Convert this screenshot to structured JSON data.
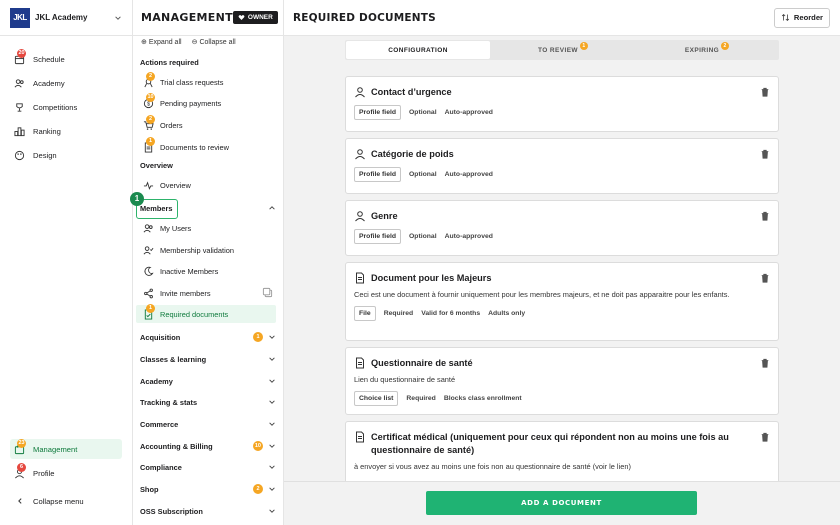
{
  "org": {
    "logo_text": "JKL",
    "name": "JKL Academy"
  },
  "leftnav": {
    "items": [
      {
        "label": "Schedule",
        "icon": "calendar-icon",
        "badge": "20"
      },
      {
        "label": "Academy",
        "icon": "users-icon"
      },
      {
        "label": "Competitions",
        "icon": "trophy-icon"
      },
      {
        "label": "Ranking",
        "icon": "ranking-icon"
      },
      {
        "label": "Design",
        "icon": "palette-icon"
      }
    ],
    "management": {
      "label": "Management",
      "badge": "23"
    },
    "profile": {
      "label": "Profile",
      "badge": "6"
    },
    "collapse": "Collapse menu"
  },
  "mgmt": {
    "title": "MANAGEMENT",
    "owner": "OWNER",
    "expand_all": "Expand all",
    "collapse_all": "Collapse all",
    "actions_required": "Actions required",
    "actions": [
      {
        "label": "Trial class requests",
        "badge": "2"
      },
      {
        "label": "Pending payments",
        "badge": "10"
      },
      {
        "label": "Orders",
        "badge": "2"
      },
      {
        "label": "Documents to review",
        "badge": "1"
      }
    ],
    "overview_section": "Overview",
    "overview_item": "Overview",
    "members_group": "Members",
    "members_items": [
      {
        "label": "My Users"
      },
      {
        "label": "Membership validation"
      },
      {
        "label": "Inactive Members"
      },
      {
        "label": "Invite members"
      },
      {
        "label": "Required documents",
        "badge": "1"
      }
    ],
    "groups": [
      {
        "label": "Acquisition",
        "badge": "1"
      },
      {
        "label": "Classes & learning"
      },
      {
        "label": "Academy"
      },
      {
        "label": "Tracking & stats"
      },
      {
        "label": "Commerce"
      },
      {
        "label": "Accounting & Billing",
        "badge": "10"
      },
      {
        "label": "Compliance"
      },
      {
        "label": "Shop",
        "badge": "2"
      },
      {
        "label": "OSS Subscription"
      }
    ],
    "step_marker": "1"
  },
  "main": {
    "title": "REQUIRED DOCUMENTS",
    "reorder": "Reorder",
    "tabs": [
      {
        "label": "CONFIGURATION"
      },
      {
        "label": "TO REVIEW",
        "badge": "1"
      },
      {
        "label": "EXPIRING",
        "badge": "2"
      }
    ],
    "cards": [
      {
        "icon": "user-icon",
        "title": "Contact d’urgence",
        "desc": "",
        "boxed": "Profile field",
        "tags": [
          "Optional",
          "Auto-approved"
        ]
      },
      {
        "icon": "user-icon",
        "title": "Catégorie de poids",
        "desc": "",
        "boxed": "Profile field",
        "tags": [
          "Optional",
          "Auto-approved"
        ]
      },
      {
        "icon": "user-icon",
        "title": "Genre",
        "desc": "",
        "boxed": "Profile field",
        "tags": [
          "Optional",
          "Auto-approved"
        ]
      },
      {
        "icon": "document-icon",
        "title": "Document pour les Majeurs",
        "desc": "Ceci est une document à fournir uniquement pour les membres majeurs, et ne doit pas apparaitre pour les enfants.",
        "boxed": "File",
        "tags": [
          "Required",
          "Valid for 6 months",
          "Adults only"
        ]
      },
      {
        "icon": "document-icon",
        "title": "Questionnaire de santé",
        "desc": "Lien du questionnaire de santé",
        "boxed": "Choice list",
        "tags": [
          "Required",
          "Blocks class enrollment"
        ]
      },
      {
        "icon": "document-icon",
        "title": "Certificat médical (uniquement pour ceux qui répondent non au moins une fois au questionnaire de santé)",
        "desc": "à envoyer si vous avez au moins une fois non au questionnaire de santé (voir le lien)",
        "boxed": "",
        "tags": []
      }
    ],
    "add_button": "ADD A DOCUMENT"
  }
}
